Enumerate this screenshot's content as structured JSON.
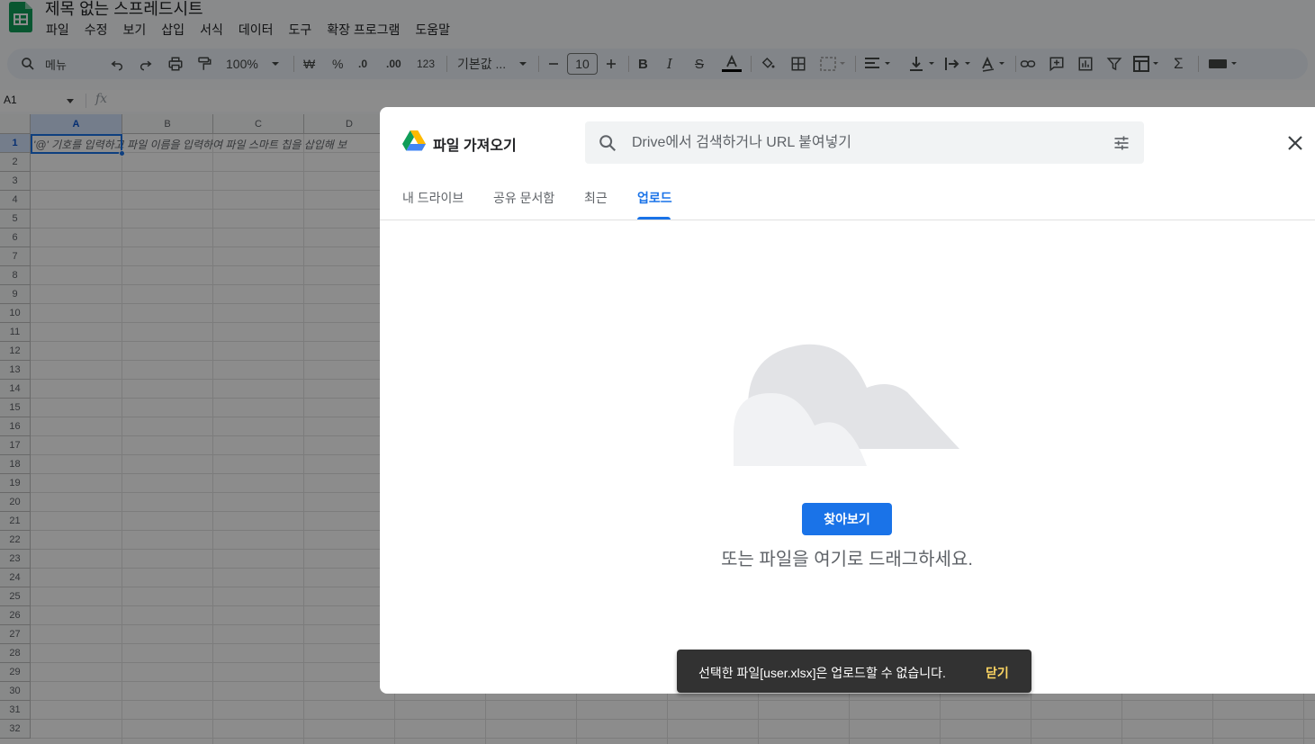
{
  "sheets": {
    "title": "제목 없는 스프레드시트",
    "menu": [
      "파일",
      "수정",
      "보기",
      "삽입",
      "서식",
      "데이터",
      "도구",
      "확장 프로그램",
      "도움말"
    ],
    "toolbar": {
      "search_menu": "메뉴",
      "zoom": "100%",
      "currency": "₩",
      "percent": "%",
      "decrease_decimal": ".0",
      "increase_decimal": ".00",
      "number_format": "123",
      "font": "기본값 ...",
      "font_size": "10"
    },
    "name_box": "A1",
    "fx": "fx",
    "columns": [
      "A",
      "B",
      "C",
      "D"
    ],
    "rows": [
      "1",
      "2",
      "3",
      "4",
      "5",
      "6",
      "7",
      "8",
      "9",
      "10",
      "11",
      "12",
      "13",
      "14",
      "15",
      "16",
      "17",
      "18",
      "19",
      "20",
      "21",
      "22",
      "23",
      "24",
      "25",
      "26",
      "27",
      "28",
      "29",
      "30",
      "31",
      "32"
    ],
    "cell_hint": "'@' 기호를 입력하고 파일 이름을 입력하여 파일 스마트 칩을 삽입해 보"
  },
  "picker": {
    "title": "파일 가져오기",
    "search_placeholder": "Drive에서 검색하거나 URL 붙여넣기",
    "tabs": [
      "내 드라이브",
      "공유 문서함",
      "최근",
      "업로드"
    ],
    "active_tab": "업로드",
    "browse_label": "찾아보기",
    "drag_text": "또는 파일을 여기로 드래그하세요."
  },
  "snackbar": {
    "message": "선택한 파일[user.xlsx]은 업로드할 수 없습니다.",
    "action": "닫기"
  },
  "colors": {
    "accent": "#1a73e8",
    "snackbar_bg": "#323232",
    "snackbar_action": "#fdd663",
    "sheets_green": "#0f9d58"
  }
}
